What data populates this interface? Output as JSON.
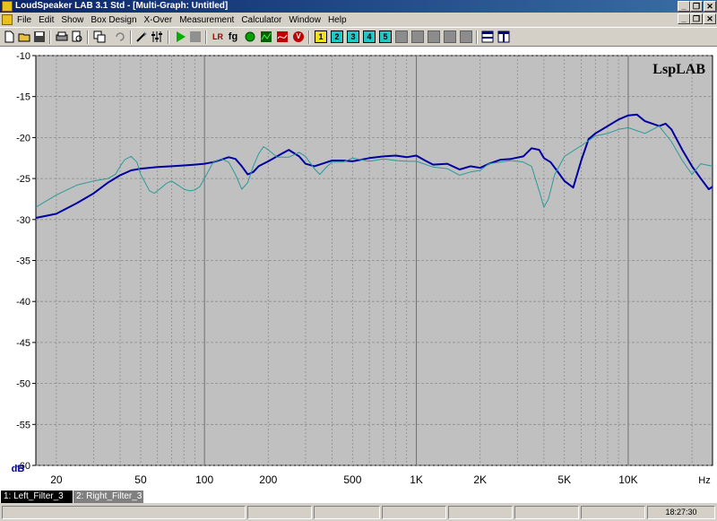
{
  "window": {
    "title": "LoudSpeaker LAB 3.1 Std - [Multi-Graph: Untitled]"
  },
  "menu": {
    "items": [
      "File",
      "Edit",
      "Show",
      "Box Design",
      "X-Over",
      "Measurement",
      "Calculator",
      "Window",
      "Help"
    ]
  },
  "toolbar": {
    "icons": [
      "new-file-icon",
      "open-folder-icon",
      "save-icon",
      "print-icon",
      "print-preview-icon",
      "copy-icon",
      "undo-icon",
      "wand-icon",
      "equalizer-icon",
      "play-icon",
      "stop-icon",
      "lr-icon",
      "fg-icon",
      "green-circle-icon",
      "scope-icon",
      "chart-icon",
      "v-icon"
    ],
    "lr_label": "LR",
    "fg_label": "fg",
    "v_label": "V",
    "numbered": [
      {
        "label": "1",
        "color": "#f0e020"
      },
      {
        "label": "2",
        "color": "#20c8c8"
      },
      {
        "label": "3",
        "color": "#20c8c8"
      },
      {
        "label": "4",
        "color": "#20c8c8"
      },
      {
        "label": "5",
        "color": "#20c8c8"
      }
    ]
  },
  "graph": {
    "watermark": "LspLAB",
    "background": "#c0c0c0",
    "grid_color": "#8c8c8c",
    "tabs": [
      {
        "label": "1: Left_Filter_3",
        "active": true
      },
      {
        "label": "2: Right_Filter_3",
        "active": false
      }
    ]
  },
  "chart_data": {
    "type": "line",
    "xlabel": "Hz",
    "ylabel": "dB",
    "x_scale": "log",
    "xlim": [
      16,
      25000
    ],
    "ylim": [
      -60,
      -10
    ],
    "x_tick_labels": [
      {
        "value": 20,
        "label": "20"
      },
      {
        "value": 50,
        "label": "50"
      },
      {
        "value": 100,
        "label": "100"
      },
      {
        "value": 200,
        "label": "200"
      },
      {
        "value": 500,
        "label": "500"
      },
      {
        "value": 1000,
        "label": "1K"
      },
      {
        "value": 2000,
        "label": "2K"
      },
      {
        "value": 5000,
        "label": "5K"
      },
      {
        "value": 10000,
        "label": "10K"
      }
    ],
    "y_ticks": [
      -10,
      -15,
      -20,
      -25,
      -30,
      -35,
      -40,
      -45,
      -50,
      -55,
      -60
    ],
    "grid": true,
    "series": [
      {
        "color": "#0000a0",
        "width": 2,
        "points": [
          [
            16,
            -29.8
          ],
          [
            20,
            -29.3
          ],
          [
            25,
            -28.0
          ],
          [
            30,
            -26.8
          ],
          [
            35,
            -25.5
          ],
          [
            40,
            -24.6
          ],
          [
            45,
            -24.0
          ],
          [
            50,
            -23.8
          ],
          [
            60,
            -23.6
          ],
          [
            70,
            -23.5
          ],
          [
            80,
            -23.4
          ],
          [
            90,
            -23.3
          ],
          [
            100,
            -23.2
          ],
          [
            110,
            -23.0
          ],
          [
            120,
            -22.7
          ],
          [
            130,
            -22.4
          ],
          [
            140,
            -22.6
          ],
          [
            150,
            -23.5
          ],
          [
            160,
            -24.5
          ],
          [
            170,
            -24.2
          ],
          [
            180,
            -23.5
          ],
          [
            200,
            -22.9
          ],
          [
            230,
            -22.0
          ],
          [
            250,
            -21.5
          ],
          [
            280,
            -22.3
          ],
          [
            300,
            -23.2
          ],
          [
            330,
            -23.5
          ],
          [
            360,
            -23.2
          ],
          [
            400,
            -22.8
          ],
          [
            450,
            -22.8
          ],
          [
            500,
            -22.9
          ],
          [
            600,
            -22.5
          ],
          [
            700,
            -22.3
          ],
          [
            800,
            -22.2
          ],
          [
            900,
            -22.4
          ],
          [
            1000,
            -22.2
          ],
          [
            1100,
            -22.8
          ],
          [
            1200,
            -23.3
          ],
          [
            1400,
            -23.2
          ],
          [
            1600,
            -23.9
          ],
          [
            1800,
            -23.5
          ],
          [
            2000,
            -23.7
          ],
          [
            2200,
            -23.2
          ],
          [
            2500,
            -22.7
          ],
          [
            2800,
            -22.6
          ],
          [
            3200,
            -22.3
          ],
          [
            3500,
            -21.3
          ],
          [
            3800,
            -21.5
          ],
          [
            4000,
            -22.5
          ],
          [
            4300,
            -23.0
          ],
          [
            4600,
            -24.0
          ],
          [
            5000,
            -25.3
          ],
          [
            5500,
            -26.1
          ],
          [
            6000,
            -22.8
          ],
          [
            6500,
            -20.2
          ],
          [
            7000,
            -19.5
          ],
          [
            8000,
            -18.6
          ],
          [
            9000,
            -17.8
          ],
          [
            10000,
            -17.3
          ],
          [
            11000,
            -17.2
          ],
          [
            12000,
            -18.0
          ],
          [
            14000,
            -18.6
          ],
          [
            15000,
            -18.3
          ],
          [
            16000,
            -19.0
          ],
          [
            18000,
            -21.5
          ],
          [
            20000,
            -23.5
          ],
          [
            22000,
            -25.0
          ],
          [
            24000,
            -26.3
          ],
          [
            25000,
            -26.0
          ]
        ]
      },
      {
        "color": "#2a9a9a",
        "width": 1,
        "points": [
          [
            16,
            -28.5
          ],
          [
            20,
            -27.0
          ],
          [
            25,
            -25.8
          ],
          [
            30,
            -25.3
          ],
          [
            35,
            -25.0
          ],
          [
            38,
            -24.5
          ],
          [
            40,
            -23.5
          ],
          [
            42,
            -22.7
          ],
          [
            45,
            -22.3
          ],
          [
            48,
            -23.0
          ],
          [
            50,
            -24.5
          ],
          [
            55,
            -26.5
          ],
          [
            58,
            -26.8
          ],
          [
            62,
            -26.2
          ],
          [
            66,
            -25.6
          ],
          [
            70,
            -25.3
          ],
          [
            75,
            -25.8
          ],
          [
            80,
            -26.3
          ],
          [
            85,
            -26.5
          ],
          [
            90,
            -26.4
          ],
          [
            95,
            -26.0
          ],
          [
            100,
            -25.0
          ],
          [
            110,
            -23.0
          ],
          [
            120,
            -22.6
          ],
          [
            130,
            -23.0
          ],
          [
            140,
            -24.5
          ],
          [
            150,
            -26.3
          ],
          [
            160,
            -25.5
          ],
          [
            170,
            -23.5
          ],
          [
            180,
            -22.0
          ],
          [
            190,
            -21.1
          ],
          [
            200,
            -21.5
          ],
          [
            220,
            -22.4
          ],
          [
            250,
            -22.4
          ],
          [
            280,
            -21.8
          ],
          [
            300,
            -22.3
          ],
          [
            330,
            -23.8
          ],
          [
            350,
            -24.5
          ],
          [
            380,
            -23.5
          ],
          [
            400,
            -23.0
          ],
          [
            450,
            -23.0
          ],
          [
            500,
            -22.5
          ],
          [
            600,
            -22.9
          ],
          [
            700,
            -22.6
          ],
          [
            800,
            -22.8
          ],
          [
            900,
            -22.9
          ],
          [
            1000,
            -22.9
          ],
          [
            1200,
            -23.6
          ],
          [
            1400,
            -23.8
          ],
          [
            1600,
            -24.6
          ],
          [
            1800,
            -24.2
          ],
          [
            2000,
            -24.0
          ],
          [
            2200,
            -23.2
          ],
          [
            2500,
            -23.0
          ],
          [
            2800,
            -22.8
          ],
          [
            3200,
            -23.0
          ],
          [
            3500,
            -23.5
          ],
          [
            3800,
            -26.5
          ],
          [
            4000,
            -28.5
          ],
          [
            4200,
            -27.5
          ],
          [
            4500,
            -24.5
          ],
          [
            5000,
            -22.3
          ],
          [
            6000,
            -21.0
          ],
          [
            7000,
            -19.8
          ],
          [
            8000,
            -19.5
          ],
          [
            9000,
            -19.0
          ],
          [
            10000,
            -18.8
          ],
          [
            12000,
            -19.5
          ],
          [
            14000,
            -18.6
          ],
          [
            16000,
            -20.5
          ],
          [
            18000,
            -22.8
          ],
          [
            20000,
            -24.5
          ],
          [
            22000,
            -23.2
          ],
          [
            24000,
            -23.4
          ],
          [
            25000,
            -23.5
          ]
        ]
      }
    ]
  },
  "status": {
    "time": "18:27:30"
  }
}
